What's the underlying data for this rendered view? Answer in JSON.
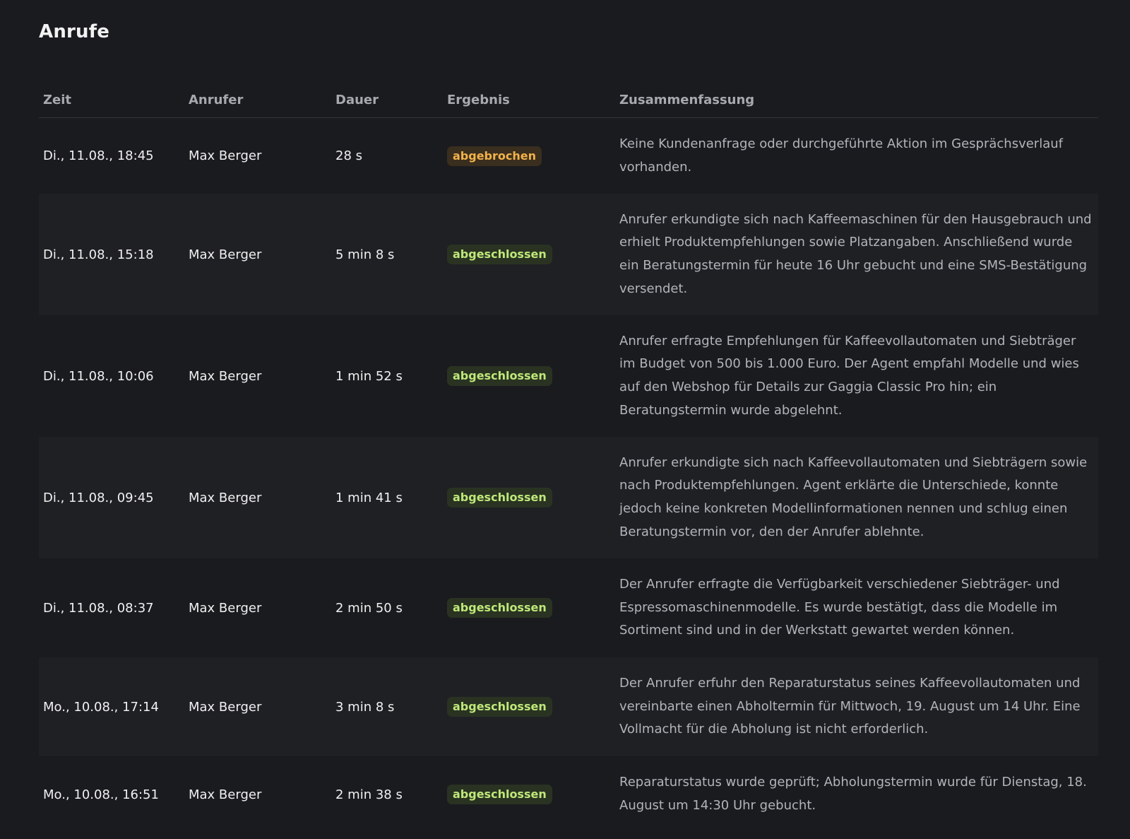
{
  "page": {
    "title": "Anrufe"
  },
  "table": {
    "headers": {
      "zeit": "Zeit",
      "anrufer": "Anrufer",
      "dauer": "Dauer",
      "ergebnis": "Ergebnis",
      "zusammenfassung": "Zusammenfassung"
    },
    "rows": [
      {
        "zeit": "Di., 11.08., 18:45",
        "anrufer": "Max Berger",
        "dauer": "28 s",
        "ergebnis": "abgebrochen",
        "zusammenfassung": "Keine Kundenanfrage oder durchgeführte Aktion im Gesprächsverlauf vorhanden."
      },
      {
        "zeit": "Di., 11.08., 15:18",
        "anrufer": "Max Berger",
        "dauer": "5 min 8 s",
        "ergebnis": "abgeschlossen",
        "zusammenfassung": "Anrufer erkundigte sich nach Kaffeemaschinen für den Hausgebrauch und erhielt Produktempfehlungen sowie Platzangaben. Anschließend wurde ein Beratungstermin für heute 16 Uhr gebucht und eine SMS-Bestätigung versendet."
      },
      {
        "zeit": "Di., 11.08., 10:06",
        "anrufer": "Max Berger",
        "dauer": "1 min 52 s",
        "ergebnis": "abgeschlossen",
        "zusammenfassung": "Anrufer erfragte Empfehlungen für Kaffeevollautomaten und Siebträger im Budget von 500 bis 1.000 Euro. Der Agent empfahl Modelle und wies auf den Webshop für Details zur Gaggia Classic Pro hin; ein Beratungstermin wurde abgelehnt."
      },
      {
        "zeit": "Di., 11.08., 09:45",
        "anrufer": "Max Berger",
        "dauer": "1 min 41 s",
        "ergebnis": "abgeschlossen",
        "zusammenfassung": "Anrufer erkundigte sich nach Kaffeevollautomaten und Siebträgern sowie nach Produktempfehlungen. Agent erklärte die Unterschiede, konnte jedoch keine konkreten Modellinformationen nennen und schlug einen Beratungstermin vor, den der Anrufer ablehnte."
      },
      {
        "zeit": "Di., 11.08., 08:37",
        "anrufer": "Max Berger",
        "dauer": "2 min 50 s",
        "ergebnis": "abgeschlossen",
        "zusammenfassung": "Der Anrufer erfragte die Verfügbarkeit verschiedener Siebträger- und Espressomaschinenmodelle. Es wurde bestätigt, dass die Modelle im Sortiment sind und in der Werkstatt gewartet werden können."
      },
      {
        "zeit": "Mo., 10.08., 17:14",
        "anrufer": "Max Berger",
        "dauer": "3 min 8 s",
        "ergebnis": "abgeschlossen",
        "zusammenfassung": "Der Anrufer erfuhr den Reparaturstatus seines Kaffeevollautomaten und vereinbarte einen Abholtermin für Mittwoch, 19. August um 14 Uhr. Eine Vollmacht für die Abholung ist nicht erforderlich."
      },
      {
        "zeit": "Mo., 10.08., 16:51",
        "anrufer": "Max Berger",
        "dauer": "2 min 38 s",
        "ergebnis": "abgeschlossen",
        "zusammenfassung": "Reparaturstatus wurde geprüft; Abholungstermin wurde für Dienstag, 18. August um 14:30 Uhr gebucht."
      }
    ]
  },
  "colors": {
    "background": "#1a1b1f",
    "row_alt": "#1f2024",
    "status_done_bg": "#2a3322",
    "status_done_text": "#bfe87a",
    "status_cancel_bg": "#3a2e1e",
    "status_cancel_text": "#f2b24a"
  }
}
